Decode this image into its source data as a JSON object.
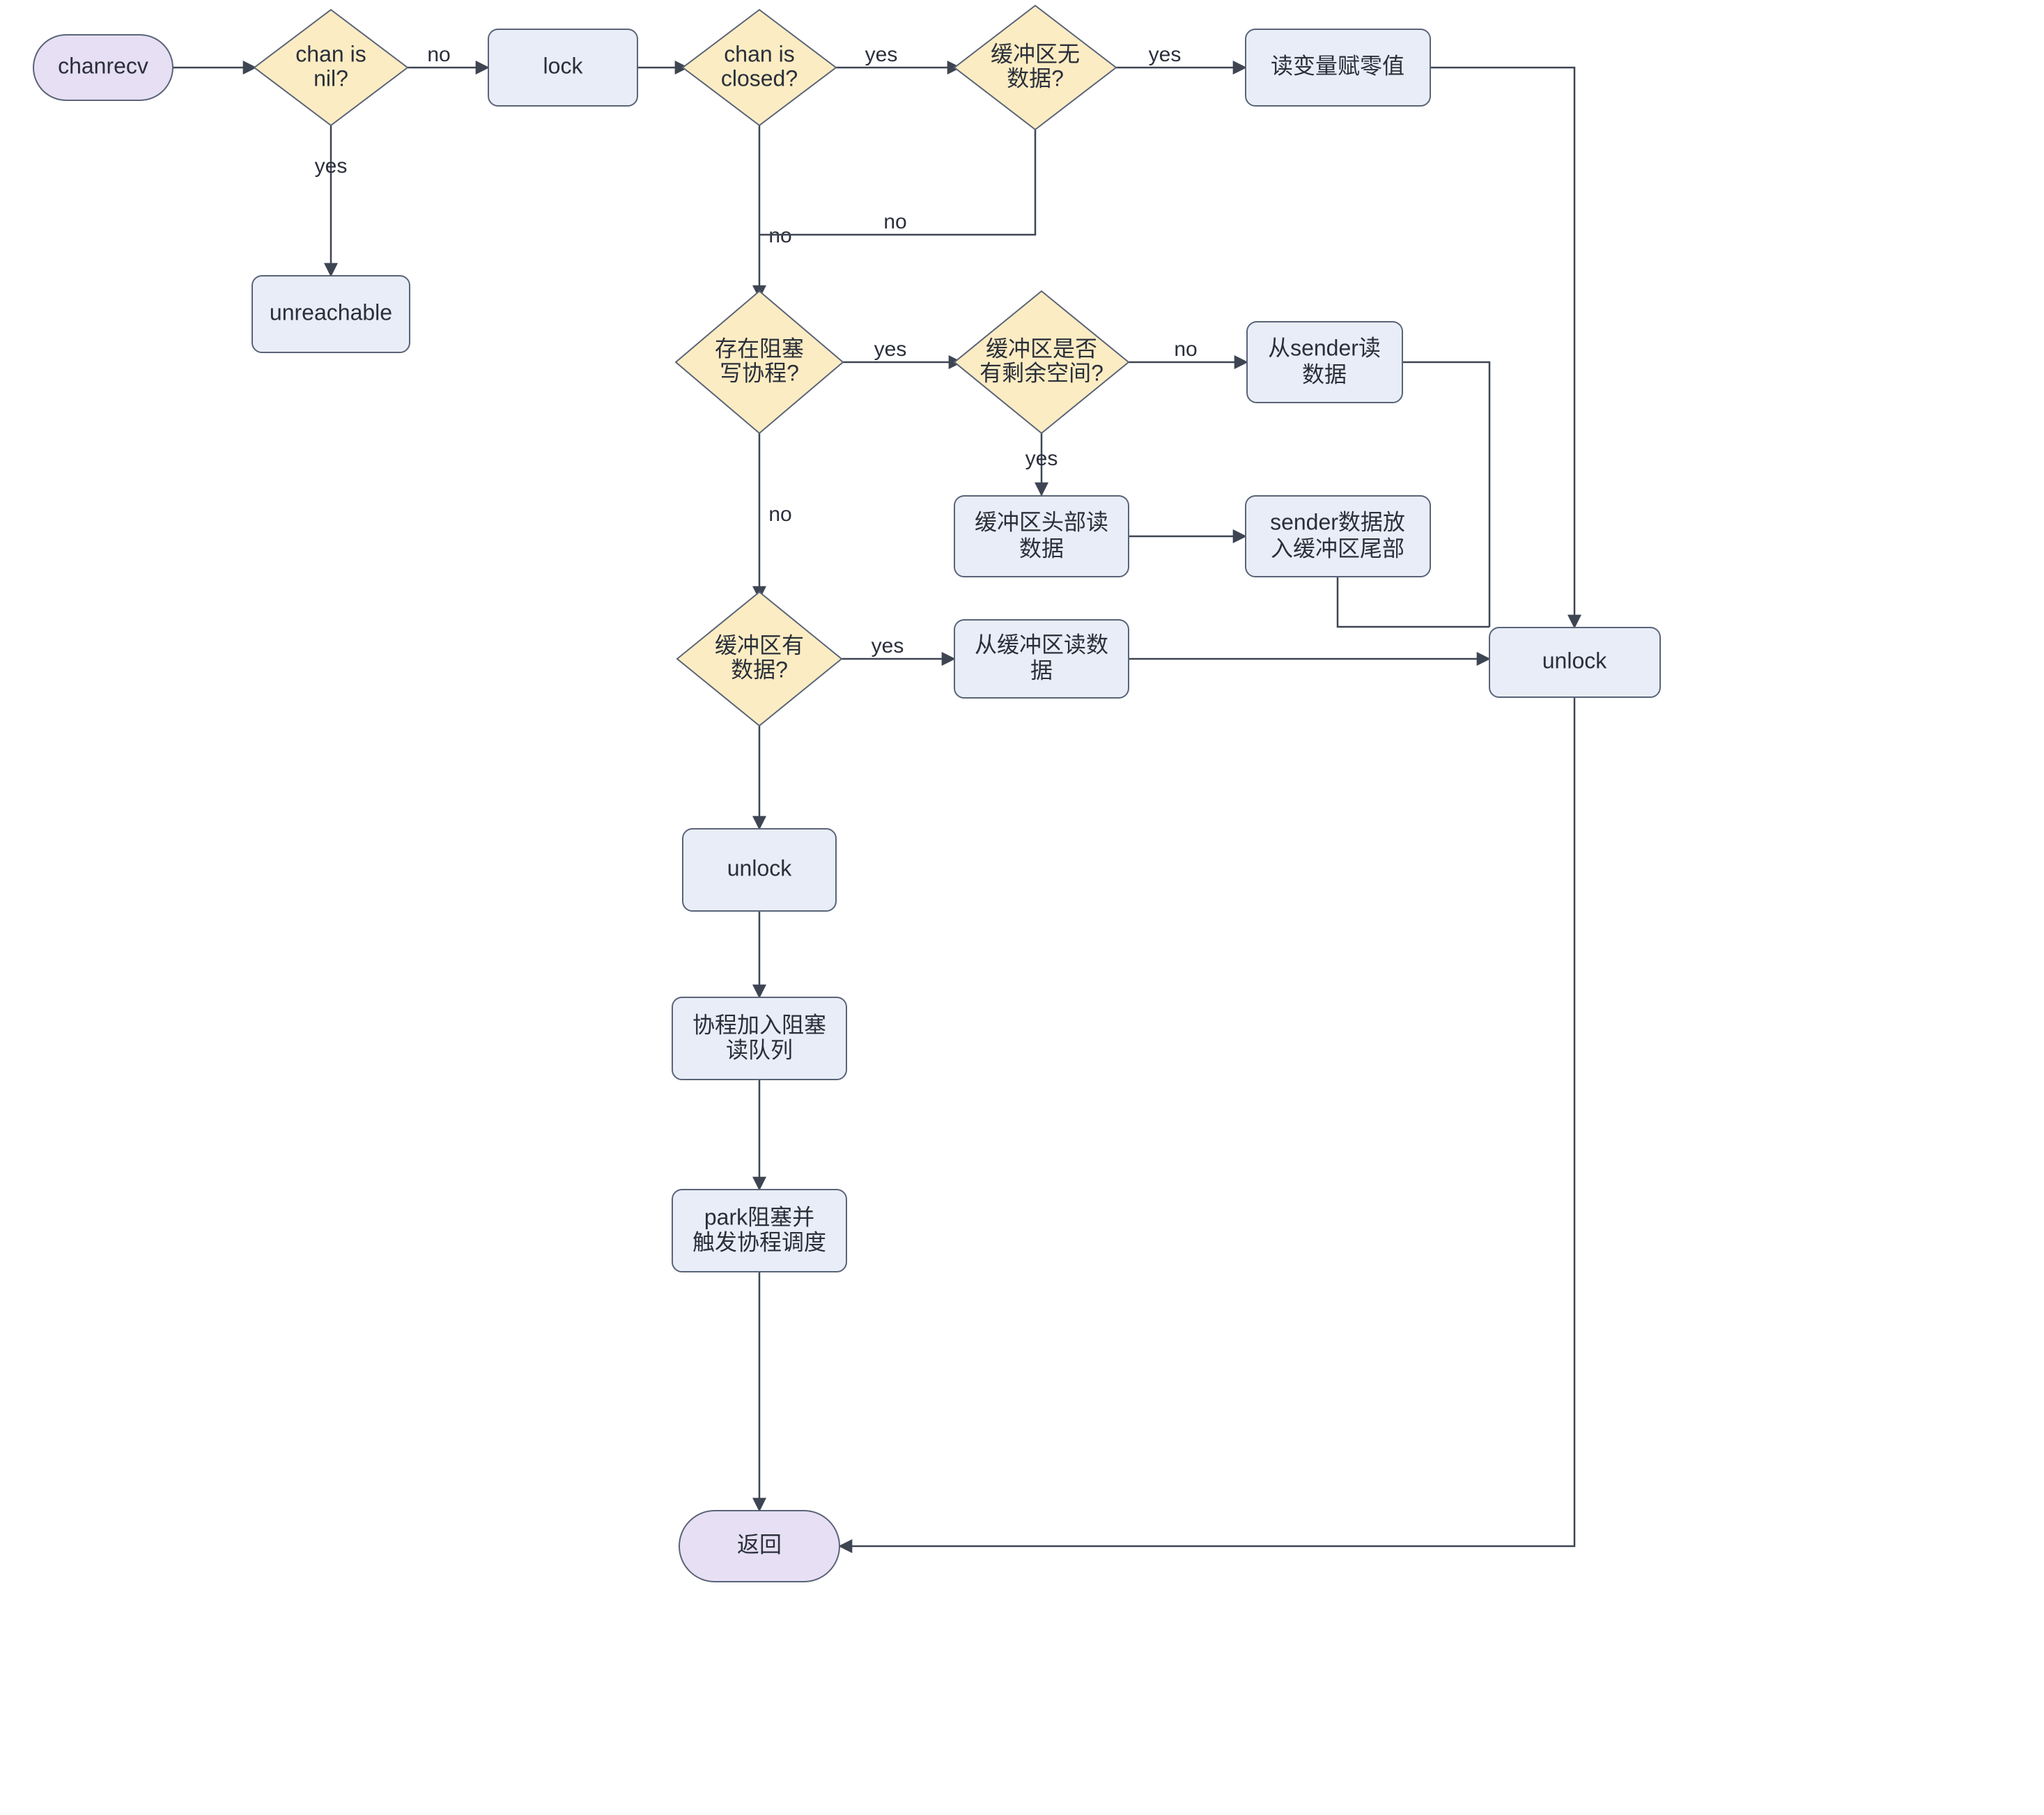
{
  "nodes": {
    "chanrecv": "chanrecv",
    "chan_is_nil": "chan is\nnil?",
    "lock": "lock",
    "chan_is_closed": "chan is\nclosed?",
    "buf_empty": "缓冲区无\n数据?",
    "read_zero": "读变量赋零值",
    "unreachable": "unreachable",
    "has_blocked_writer": "存在阻塞\n写协程?",
    "buf_has_space": "缓冲区是否\n有剩余空间?",
    "read_from_sender": "从sender读\n数据",
    "read_buf_head": "缓冲区头部读\n数据",
    "sender_to_tail": "sender数据放\n入缓冲区尾部",
    "buf_has_data": "缓冲区有\n数据?",
    "read_from_buf": "从缓冲区读数\n据",
    "unlock2": "unlock",
    "join_recvq": "协程加入阻塞\n读队列",
    "park": "park阻塞并\n触发协程调度",
    "unlock": "unlock",
    "return": "返回"
  },
  "edges": {
    "yes": "yes",
    "no": "no"
  }
}
